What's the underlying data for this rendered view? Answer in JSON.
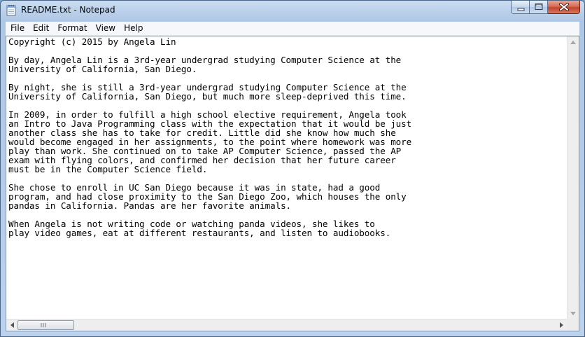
{
  "window": {
    "title": "README.txt - Notepad",
    "icon": "notepad-icon"
  },
  "caption_buttons": {
    "minimize_icon": "minimize-icon",
    "maximize_icon": "maximize-icon",
    "close_icon": "close-icon"
  },
  "menu": {
    "file": "File",
    "edit": "Edit",
    "format": "Format",
    "view": "View",
    "help": "Help"
  },
  "document": {
    "text": "Copyright (c) 2015 by Angela Lin\n\nBy day, Angela Lin is a 3rd-year undergrad studying Computer Science at the\nUniversity of California, San Diego.\n\nBy night, she is still a 3rd-year undergrad studying Computer Science at the\nUniversity of California, San Diego, but much more sleep-deprived this time.\n\nIn 2009, in order to fulfill a high school elective requirement, Angela took\nan Intro to Java Programming class with the expectation that it would be just\nanother class she has to take for credit. Little did she know how much she\nwould become engaged in her assignments, to the point where homework was more\nplay than work. She continued on to take AP Computer Science, passed the AP\nexam with flying colors, and confirmed her decision that her future career\nmust be in the Computer Science field.\n\nShe chose to enroll in UC San Diego because it was in state, had a good\nprogram, and had close proximity to the San Diego Zoo, which houses the only\npandas in California. Pandas are her favorite animals.\n\nWhen Angela is not writing code or watching panda videos, she likes to\nplay video games, eat at different restaurants, and listen to audiobooks."
  },
  "colors": {
    "titlebar": "#b9d1ea",
    "close_button": "#c7432a",
    "editor_background": "#ffffff"
  }
}
